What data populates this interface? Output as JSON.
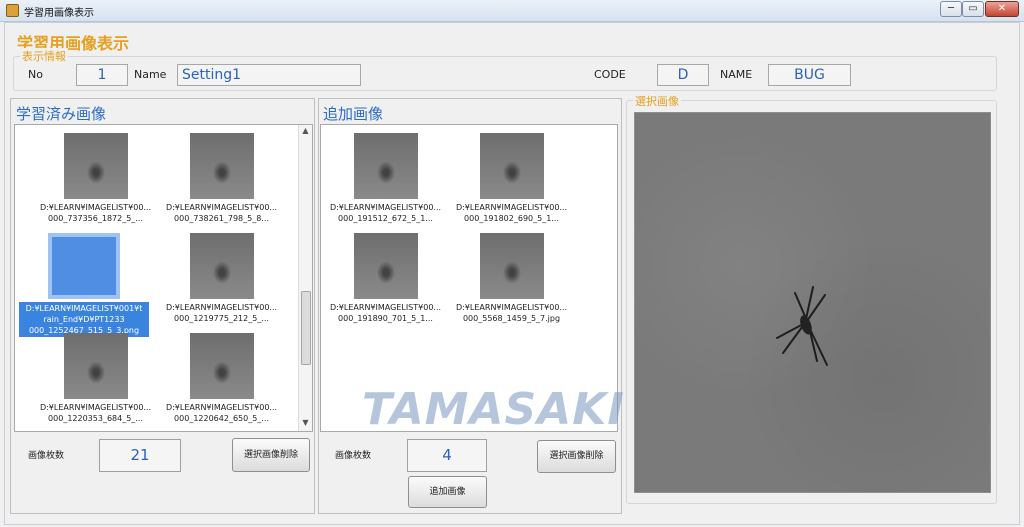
{
  "window": {
    "title": "学習用画像表示"
  },
  "heading": "学習用画像表示",
  "info": {
    "legend": "表示情報",
    "no_label": "No",
    "no_value": "1",
    "name_label": "Name",
    "name_value": "Setting1",
    "code_label": "CODE",
    "code_value": "D",
    "name2_label": "NAME",
    "name2_value": "BUG"
  },
  "learned": {
    "title": "学習済み画像",
    "items": [
      {
        "caption": "D:¥LEARN¥IMAGELIST¥00...\n000_737356_1872_5_..."
      },
      {
        "caption": "D:¥LEARN¥IMAGELIST¥00...\n000_738261_798_5_8..."
      },
      {
        "caption": "D:¥LEARN¥IMAGELIST¥001¥t\nrain_End¥D¥PT1233\n000_1252467_515_5_3.png"
      },
      {
        "caption": "D:¥LEARN¥IMAGELIST¥00...\n000_1219775_212_5_..."
      },
      {
        "caption": "D:¥LEARN¥IMAGELIST¥00...\n000_1220353_684_5_..."
      },
      {
        "caption": "D:¥LEARN¥IMAGELIST¥00...\n000_1220642_650_5_..."
      }
    ],
    "count_label": "画像枚数",
    "count_value": "21",
    "delete_button": "選択画像削除"
  },
  "added": {
    "title": "追加画像",
    "items": [
      {
        "caption": "D:¥LEARN¥IMAGELIST¥00...\n000_191512_672_5_1..."
      },
      {
        "caption": "D:¥LEARN¥IMAGELIST¥00...\n000_191802_690_5_1..."
      },
      {
        "caption": "D:¥LEARN¥IMAGELIST¥00...\n000_191890_701_5_1..."
      },
      {
        "caption": "D:¥LEARN¥IMAGELIST¥00...\n000_5568_1459_5_7.jpg"
      }
    ],
    "count_label": "画像枚数",
    "count_value": "4",
    "delete_button": "選択画像削除",
    "add_button": "追加画像"
  },
  "preview": {
    "legend": "選択画像"
  },
  "watermark": "TAMASAKI",
  "window_controls": {
    "minimize": "─",
    "maximize": "▭",
    "close": "✕"
  }
}
